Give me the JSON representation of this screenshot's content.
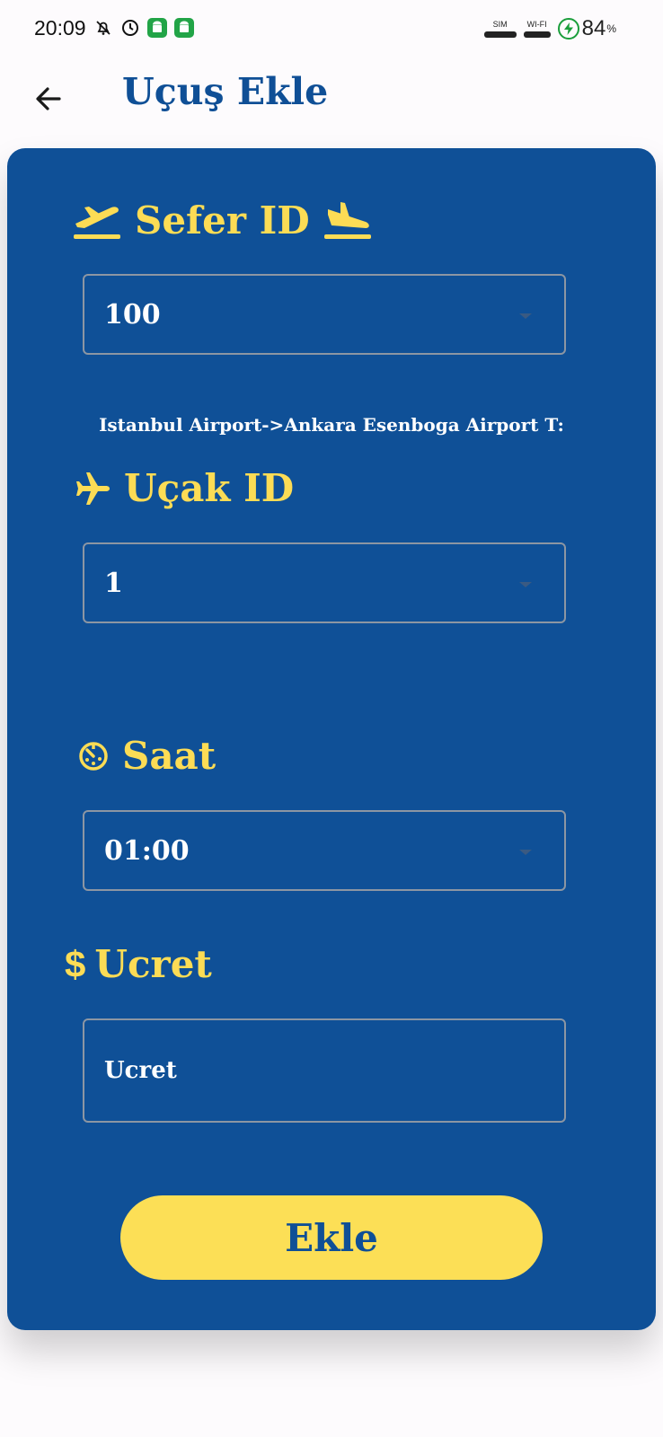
{
  "status_bar": {
    "time": "20:09",
    "sim_label": "SIM",
    "wifi_label": "WI-FI",
    "battery_percent": "84",
    "battery_unit": "%"
  },
  "app_bar": {
    "title": "Uçuş Ekle",
    "back_icon": "arrow-left-icon"
  },
  "form": {
    "sefer": {
      "label": "Sefer ID",
      "value": "100",
      "route": "Istanbul Airport->Ankara Esenboga Airport T:"
    },
    "ucak": {
      "label": "Uçak ID",
      "value": "1"
    },
    "saat": {
      "label": "Saat",
      "value": "01:00"
    },
    "ucret": {
      "label": "Ucret",
      "symbol": "$",
      "placeholder": "Ucret"
    },
    "submit_label": "Ekle"
  },
  "colors": {
    "card_bg": "#0f5097",
    "accent_yellow": "#fcdc55",
    "title_blue": "#0f4f96",
    "input_text": "#ffffff"
  }
}
